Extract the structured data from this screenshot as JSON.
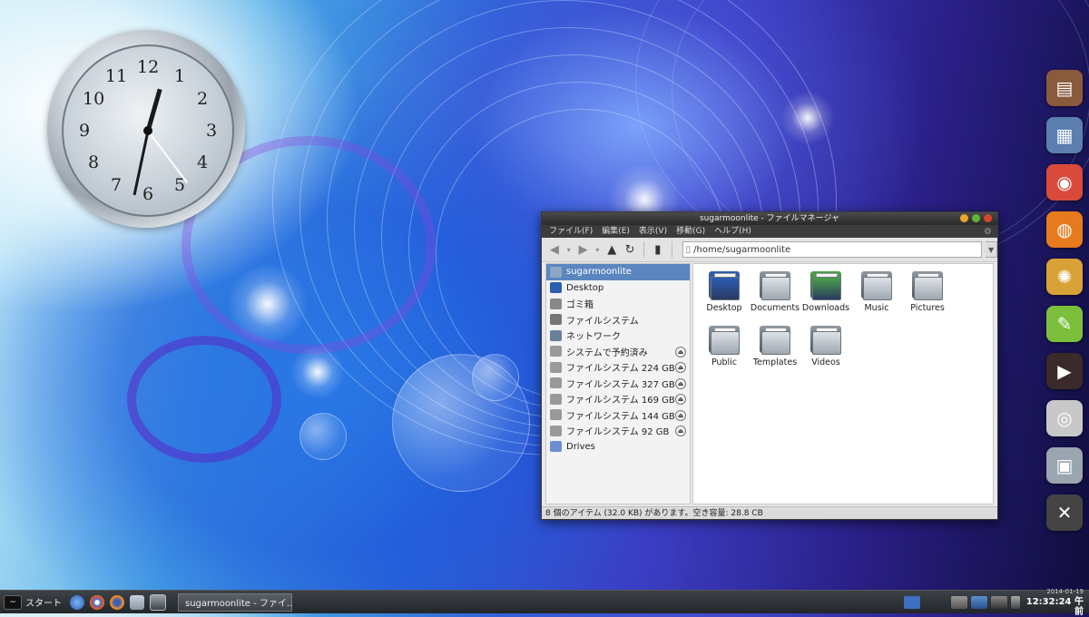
{
  "clock": {
    "numbers": [
      "12",
      "1",
      "2",
      "3",
      "4",
      "5",
      "6",
      "7",
      "8",
      "9",
      "10",
      "11"
    ]
  },
  "dock": {
    "items": [
      {
        "name": "dock-cabinet",
        "icon": "cabinet-icon",
        "color": "#8a5a3c",
        "glyph": "▤"
      },
      {
        "name": "dock-file-manager",
        "icon": "file-manager-icon",
        "color": "#5c7fb0",
        "glyph": "▦"
      },
      {
        "name": "dock-chrome",
        "icon": "chrome-icon",
        "color": "#d94a3a",
        "glyph": "◉"
      },
      {
        "name": "dock-firefox",
        "icon": "firefox-icon",
        "color": "#e77a1e",
        "glyph": "◍"
      },
      {
        "name": "dock-paint",
        "icon": "palette-icon",
        "color": "#d8a236",
        "glyph": "✺"
      },
      {
        "name": "dock-notes",
        "icon": "notepad-icon",
        "color": "#7cbf3c",
        "glyph": "✎"
      },
      {
        "name": "dock-media",
        "icon": "media-player-icon",
        "color": "#3a2a2a",
        "glyph": "▶"
      },
      {
        "name": "dock-disc",
        "icon": "disc-burner-icon",
        "color": "#c8c8c8",
        "glyph": "◎"
      },
      {
        "name": "dock-packages",
        "icon": "package-icon",
        "color": "#9aa5b0",
        "glyph": "▣"
      },
      {
        "name": "dock-tools",
        "icon": "tools-icon",
        "color": "#444",
        "glyph": "✕"
      }
    ]
  },
  "window": {
    "title": "sugarmoonlite - ファイルマネージャ",
    "menus": [
      "ファイル(F)",
      "編集(E)",
      "表示(V)",
      "移動(G)",
      "ヘルプ(H)"
    ],
    "path": "/home/sugarmoonlite",
    "sidebar": [
      {
        "label": "sugarmoonlite",
        "icon": "home-icon",
        "color": "#8fa6c2",
        "selected": true,
        "eject": false
      },
      {
        "label": "Desktop",
        "icon": "desktop-icon",
        "color": "#2b5fb0",
        "selected": false,
        "eject": false
      },
      {
        "label": "ゴミ箱",
        "icon": "trash-icon",
        "color": "#888",
        "selected": false,
        "eject": false
      },
      {
        "label": "ファイルシステム",
        "icon": "drive-icon",
        "color": "#777",
        "selected": false,
        "eject": false
      },
      {
        "label": "ネットワーク",
        "icon": "network-icon",
        "color": "#6a7f99",
        "selected": false,
        "eject": false
      },
      {
        "label": "システムで予約済み",
        "icon": "drive-icon",
        "color": "#999",
        "selected": false,
        "eject": true
      },
      {
        "label": "ファイルシステム 224 GB",
        "icon": "drive-icon",
        "color": "#999",
        "selected": false,
        "eject": true
      },
      {
        "label": "ファイルシステム 327 GB",
        "icon": "drive-icon",
        "color": "#999",
        "selected": false,
        "eject": true
      },
      {
        "label": "ファイルシステム 169 GB",
        "icon": "drive-icon",
        "color": "#999",
        "selected": false,
        "eject": true
      },
      {
        "label": "ファイルシステム 144 GB",
        "icon": "drive-icon",
        "color": "#999",
        "selected": false,
        "eject": true
      },
      {
        "label": "ファイルシステム 92 GB",
        "icon": "drive-icon",
        "color": "#999",
        "selected": false,
        "eject": true
      },
      {
        "label": "Drives",
        "icon": "drives-folder-icon",
        "color": "#6b8fd0",
        "selected": false,
        "eject": false
      }
    ],
    "files": [
      {
        "label": "Desktop",
        "icon": "desktop-folder-icon",
        "color": "#2c5db4"
      },
      {
        "label": "Documents",
        "icon": "documents-folder-icon",
        "color": "#8e98a3"
      },
      {
        "label": "Downloads",
        "icon": "downloads-folder-icon",
        "color": "#4aa04a"
      },
      {
        "label": "Music",
        "icon": "music-folder-icon",
        "color": "#8e98a3"
      },
      {
        "label": "Pictures",
        "icon": "pictures-folder-icon",
        "color": "#8e98a3"
      },
      {
        "label": "Public",
        "icon": "public-folder-icon",
        "color": "#8e98a3"
      },
      {
        "label": "Templates",
        "icon": "templates-folder-icon",
        "color": "#8e98a3"
      },
      {
        "label": "Videos",
        "icon": "videos-folder-icon",
        "color": "#8e98a3"
      }
    ],
    "status": "8 個のアイテム (32.0 KB) があります。空き容量: 28.8 CB"
  },
  "taskbar": {
    "start_label": "スタート",
    "task_label": "sugarmoonlite - ファイ...",
    "date": "2014-01-19",
    "time": "12:32:24 午前"
  }
}
